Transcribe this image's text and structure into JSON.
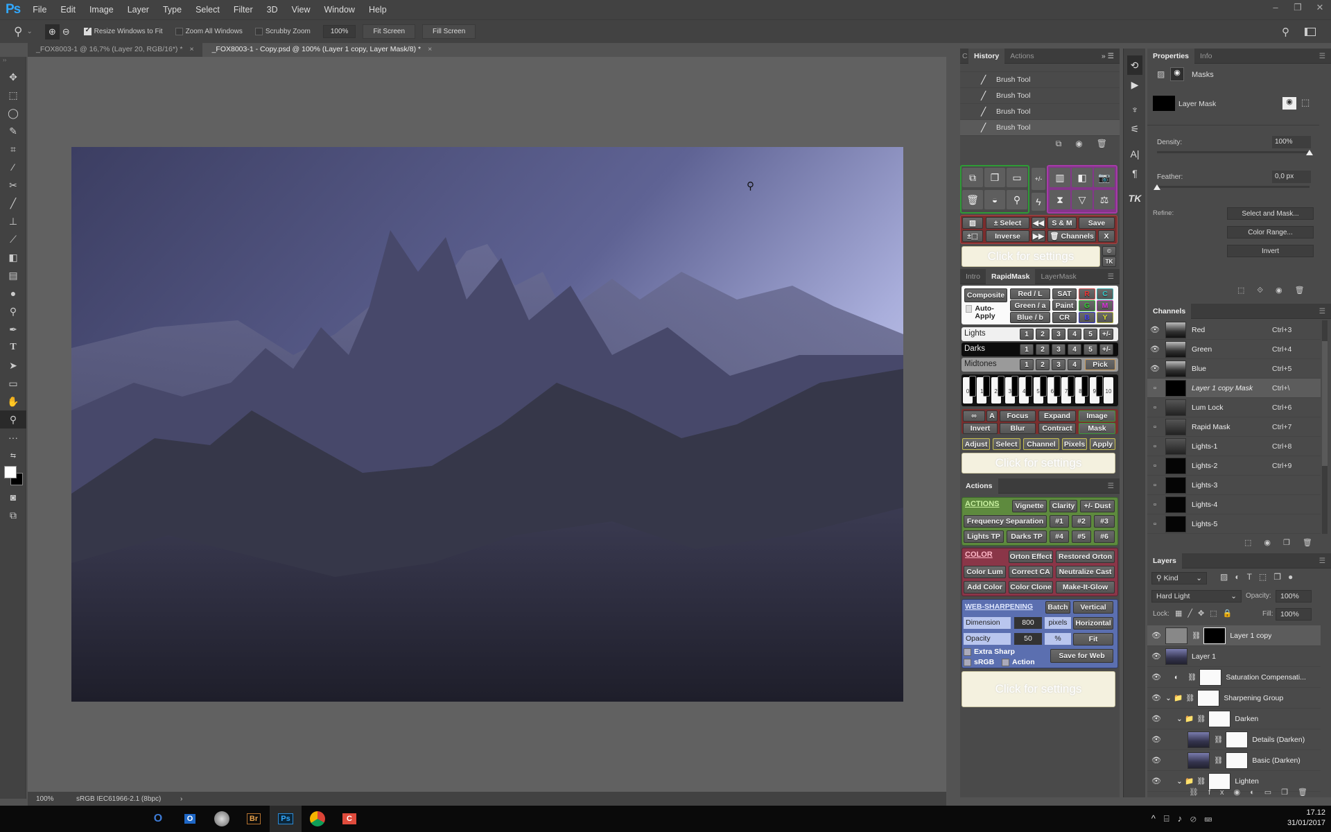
{
  "app": {
    "logo": "Ps",
    "name": "Adobe Photoshop"
  },
  "menu": [
    "File",
    "Edit",
    "Image",
    "Layer",
    "Type",
    "Select",
    "Filter",
    "3D",
    "View",
    "Window",
    "Help"
  ],
  "window_controls": {
    "minimize": "–",
    "restore": "❐",
    "close": "✕"
  },
  "options_bar": {
    "zoom_in_icon": "zoom-in-icon",
    "resize_windows": {
      "label": "Resize Windows to Fit",
      "checked": true
    },
    "zoom_all": {
      "label": "Zoom All Windows",
      "checked": false
    },
    "scrubby": {
      "label": "Scrubby Zoom",
      "checked": false
    },
    "zoom_value": "100%",
    "fit_screen": "Fit Screen",
    "fill_screen": "Fill Screen"
  },
  "doc_tabs": [
    {
      "label": "_FOX8003-1 @ 16,7% (Layer 20, RGB/16*) *",
      "active": false
    },
    {
      "label": "_FOX8003-1 - Copy.psd @ 100% (Layer 1 copy, Layer Mask/8) *",
      "active": true
    }
  ],
  "tools": [
    "move",
    "marquee",
    "lasso",
    "quick-select",
    "crop",
    "eyedropper",
    "healing",
    "brush",
    "clone-stamp",
    "history-brush",
    "eraser",
    "gradient",
    "blur",
    "dodge",
    "pen",
    "type",
    "path-select",
    "rectangle",
    "hand",
    "zoom",
    "more",
    "swap-colors",
    "colors",
    "quick-mask",
    "screen-mode"
  ],
  "status": {
    "zoom": "100%",
    "profile": "sRGB IEC61966-2.1 (8bpc)",
    "arrow": "›"
  },
  "history": {
    "tabs": [
      "History",
      "Actions"
    ],
    "items": [
      "Brush Tool",
      "Brush Tool",
      "Brush Tool",
      "Brush Tool"
    ]
  },
  "rapid_top": {
    "select": "± Select",
    "sm": "S & M",
    "save": "Save",
    "inverse": "Inverse",
    "channels": "Channels",
    "x": "X",
    "settings": "Click for settings",
    "tk": "TK"
  },
  "rapidmask": {
    "tabs": [
      "Intro",
      "RapidMask",
      "LayerMask"
    ],
    "composite": "Composite",
    "auto_apply": "Auto-Apply",
    "channels": [
      "Red / L",
      "Green / a",
      "Blue / b"
    ],
    "sat": "SAT",
    "paint": "Paint",
    "cr": "CR",
    "colors": [
      "R",
      "C",
      "G",
      "M",
      "B",
      "Y"
    ],
    "lights": "Lights",
    "darks": "Darks",
    "midtones": "Midtones",
    "nums": [
      "1",
      "2",
      "3",
      "4",
      "5",
      "+/-"
    ],
    "mid_nums": [
      "1",
      "2",
      "3",
      "4"
    ],
    "pick": "Pick",
    "zones": [
      "0",
      "1",
      "2",
      "3",
      "4",
      "5",
      "6",
      "7",
      "8",
      "9",
      "10"
    ],
    "row1": [
      "∞",
      "A",
      "Focus",
      "Expand",
      "Image"
    ],
    "row2": [
      "Invert",
      "Blur",
      "Contract",
      "Mask"
    ],
    "row3": [
      "Adjust",
      "Select",
      "Channel",
      "Pixels",
      "Apply"
    ],
    "settings": "Click for settings"
  },
  "actions_panel": {
    "title": "Actions",
    "actions_label": "ACTIONS",
    "a_row1": [
      "Vignette",
      "Clarity",
      "+/- Dust"
    ],
    "a_row2": [
      "Frequency Separation",
      "#1",
      "#2",
      "#3"
    ],
    "a_row3": [
      "Lights TP",
      "Darks TP",
      "#4",
      "#5",
      "#6"
    ],
    "color_label": "COLOR",
    "c_row1": [
      "Orton Effect",
      "Restored Orton"
    ],
    "c_row2": [
      "Color Lum",
      "Correct CA",
      "Neutralize Cast"
    ],
    "c_row3": [
      "Add Color",
      "Color Clone",
      "Make-It-Glow"
    ],
    "web_label": "WEB-SHARPENING",
    "batch": "Batch",
    "vertical": "Vertical",
    "horizontal": "Horizontal",
    "fit": "Fit",
    "dimension": "Dimension",
    "dimension_value": "800",
    "pixels": "pixels",
    "opacity": "Opacity",
    "opacity_value": "50",
    "percent": "%",
    "extra_sharp": "Extra Sharp",
    "srgb": "sRGB",
    "action": "Action",
    "save_for_web": "Save for Web",
    "settings": "Click for settings"
  },
  "properties": {
    "tabs": [
      "Properties",
      "Info"
    ],
    "masks": "Masks",
    "layer_mask": "Layer Mask",
    "density_label": "Density:",
    "density": "100%",
    "density_fraction": 1.0,
    "feather_label": "Feather:",
    "feather": "0,0 px",
    "feather_fraction": 0.0,
    "refine": "Refine:",
    "select_and_mask": "Select and Mask...",
    "color_range": "Color Range...",
    "invert": "Invert"
  },
  "channels": {
    "title": "Channels",
    "rows": [
      {
        "name": "Red",
        "shortcut": "Ctrl+3",
        "visible": true
      },
      {
        "name": "Green",
        "shortcut": "Ctrl+4",
        "visible": true
      },
      {
        "name": "Blue",
        "shortcut": "Ctrl+5",
        "visible": true
      },
      {
        "name": "Layer 1 copy Mask",
        "shortcut": "Ctrl+\\",
        "visible": false,
        "selected": true
      },
      {
        "name": "Lum Lock",
        "shortcut": "Ctrl+6",
        "visible": false
      },
      {
        "name": "Rapid Mask",
        "shortcut": "Ctrl+7",
        "visible": false
      },
      {
        "name": "Lights-1",
        "shortcut": "Ctrl+8",
        "visible": false
      },
      {
        "name": "Lights-2",
        "shortcut": "Ctrl+9",
        "visible": false
      },
      {
        "name": "Lights-3",
        "shortcut": "",
        "visible": false
      },
      {
        "name": "Lights-4",
        "shortcut": "",
        "visible": false
      },
      {
        "name": "Lights-5",
        "shortcut": "",
        "visible": false
      }
    ]
  },
  "layers": {
    "title": "Layers",
    "kind": "Kind",
    "blend": "Hard Light",
    "opacity_label": "Opacity:",
    "opacity": "100%",
    "lock_label": "Lock:",
    "fill_label": "Fill:",
    "fill": "100%",
    "rows": [
      {
        "name": "Layer 1 copy",
        "selected": true
      },
      {
        "name": "Layer 1"
      },
      {
        "name": "Saturation Compensati..."
      },
      {
        "name": "Sharpening Group"
      },
      {
        "name": "Darken"
      },
      {
        "name": "Details (Darken)"
      },
      {
        "name": "Basic (Darken)"
      },
      {
        "name": "Lighten"
      }
    ]
  },
  "taskbar": {
    "time": "17.12",
    "date": "31/01/2017",
    "apps": [
      "Outlook",
      "Outlook",
      "Steam",
      "Bridge",
      "Photoshop",
      "Chrome",
      "Camtasia"
    ]
  }
}
